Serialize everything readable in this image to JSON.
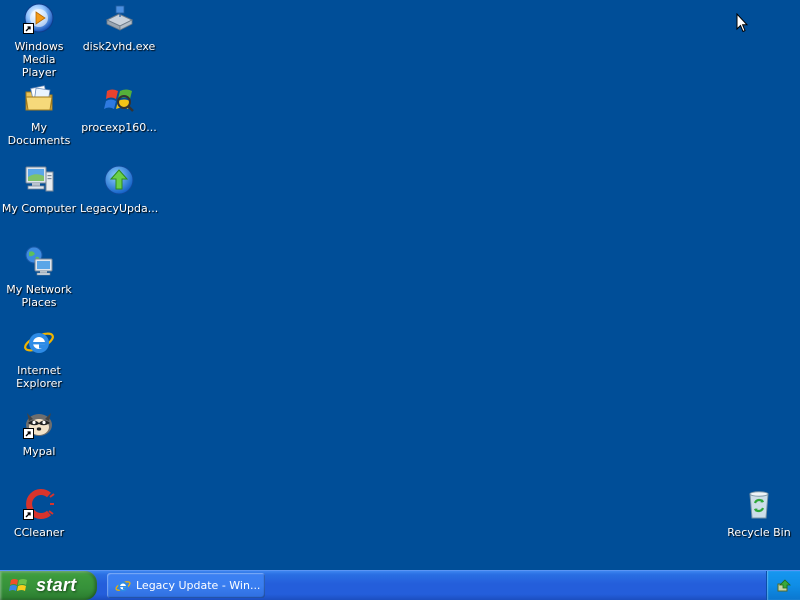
{
  "desktop": {
    "background_color": "#004e98",
    "icons": [
      {
        "label": "Windows Media\nPlayer",
        "icon": "windows-media-player-icon",
        "shortcut": true
      },
      {
        "label": "My Documents",
        "icon": "my-documents-icon",
        "shortcut": false
      },
      {
        "label": "My Computer",
        "icon": "my-computer-icon",
        "shortcut": false
      },
      {
        "label": "My Network\nPlaces",
        "icon": "my-network-places-icon",
        "shortcut": false
      },
      {
        "label": "Internet\nExplorer",
        "icon": "internet-explorer-icon",
        "shortcut": false
      },
      {
        "label": "Mypal",
        "icon": "mypal-icon",
        "shortcut": true
      },
      {
        "label": "CCleaner",
        "icon": "ccleaner-icon",
        "shortcut": true
      },
      {
        "label": "disk2vhd.exe",
        "icon": "disk2vhd-icon",
        "shortcut": false
      },
      {
        "label": "procexp160...",
        "icon": "process-explorer-icon",
        "shortcut": false
      },
      {
        "label": "LegacyUpda...",
        "icon": "legacy-update-icon",
        "shortcut": false
      },
      {
        "label": "Recycle Bin",
        "icon": "recycle-bin-icon",
        "shortcut": false
      }
    ]
  },
  "taskbar": {
    "start_label": "start",
    "tasks": [
      {
        "label": "Legacy Update - Win...",
        "icon": "internet-explorer-icon"
      }
    ],
    "tray": {
      "icon": "safely-remove-hardware-icon"
    }
  }
}
